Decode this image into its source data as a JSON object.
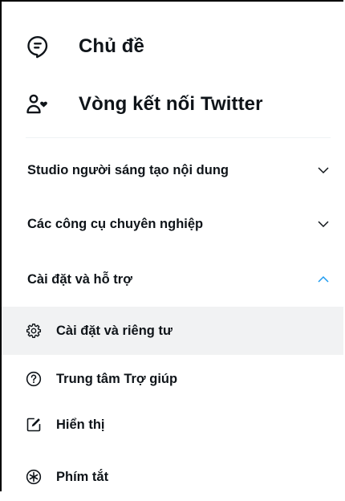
{
  "menu": {
    "topics": {
      "label": "Chủ đề",
      "icon": "topics-icon"
    },
    "circle": {
      "label": "Vòng kết nối Twitter",
      "icon": "twitter-circle-icon"
    }
  },
  "sections": {
    "creator_studio": {
      "label": "Studio người sáng tạo nội dung",
      "expanded": false
    },
    "professional_tools": {
      "label": "Các công cụ chuyên nghiệp",
      "expanded": false
    },
    "settings_support": {
      "label": "Cài đặt và hỗ trợ",
      "expanded": true
    }
  },
  "submenu": [
    {
      "label": "Cài đặt và riêng tư",
      "icon": "gear-icon",
      "active": true
    },
    {
      "label": "Trung tâm Trợ giúp",
      "icon": "help-circle-icon",
      "active": false
    },
    {
      "label": "Hiển thị",
      "icon": "edit-display-icon",
      "active": false
    },
    {
      "label": "Phím tắt",
      "icon": "keyboard-shortcut-icon",
      "active": false
    }
  ],
  "colors": {
    "accent": "#1d9bf0",
    "text": "#0f1419",
    "hover": "#f1f2f3"
  }
}
